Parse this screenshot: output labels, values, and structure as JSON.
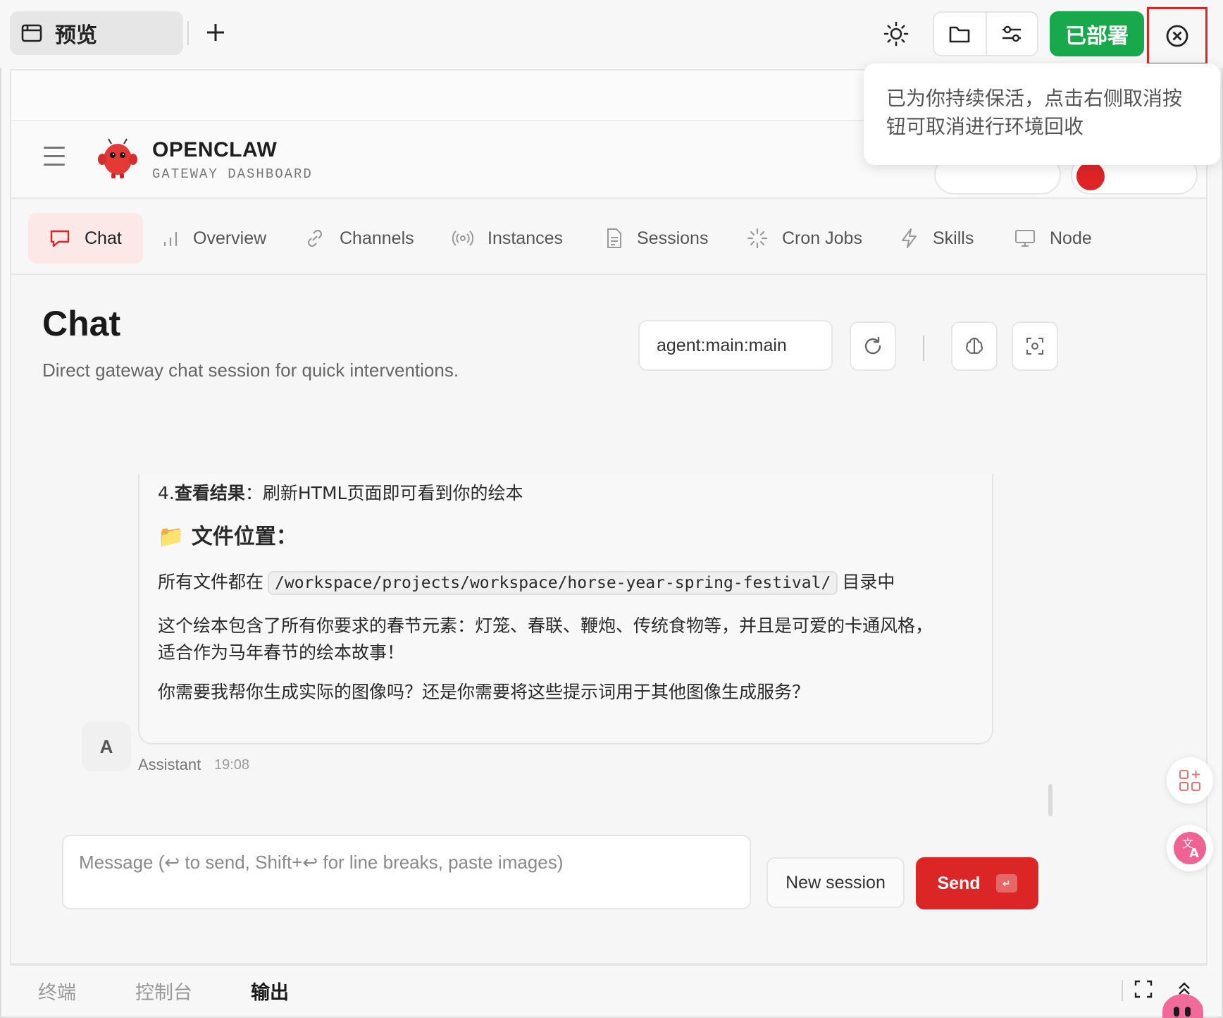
{
  "topbar": {
    "preview_tab_label": "预览",
    "deployed_label": "已部署"
  },
  "tooltip": {
    "text": "已为你持续保活，点击右侧取消按钮可取消进行环境回收"
  },
  "brand": {
    "title": "OPENCLAW",
    "subtitle": "GATEWAY DASHBOARD"
  },
  "nav": {
    "items": [
      {
        "label": "Chat",
        "icon": "chat-bubble-icon",
        "active": true
      },
      {
        "label": "Overview",
        "icon": "bar-chart-icon"
      },
      {
        "label": "Channels",
        "icon": "link-icon"
      },
      {
        "label": "Instances",
        "icon": "broadcast-icon"
      },
      {
        "label": "Sessions",
        "icon": "document-icon"
      },
      {
        "label": "Cron Jobs",
        "icon": "loader-icon"
      },
      {
        "label": "Skills",
        "icon": "lightning-icon"
      },
      {
        "label": "Node",
        "icon": "monitor-icon"
      }
    ]
  },
  "chat": {
    "title": "Chat",
    "subtitle": "Direct gateway chat session for quick interventions.",
    "session_value": "agent:main:main"
  },
  "message": {
    "step_number": "4.",
    "step_bold": "查看结果",
    "step_rest": "：刷新HTML页面即可看到你的绘本",
    "file_emoji": "📁",
    "file_heading": "文件位置：",
    "files_prefix": "所有文件都在",
    "files_path": "/workspace/projects/workspace/horse-year-spring-festival/",
    "files_suffix": "目录中",
    "para1_line1": "这个绘本包含了所有你要求的春节元素：灯笼、春联、鞭炮、传统食物等，并且是可爱的卡通风格，",
    "para1_line2": "适合作为马年春节的绘本故事！",
    "para2": "你需要我帮你生成实际的图像吗？还是你需要将这些提示词用于其他图像生成服务？",
    "avatar_letter": "A",
    "sender": "Assistant",
    "time": "19:08"
  },
  "composer": {
    "placeholder": "Message (↩ to send, Shift+↩ for line breaks, paste images)",
    "new_session_label": "New session",
    "send_label": "Send",
    "send_kbd": "↵"
  },
  "bottom": {
    "tabs": [
      {
        "label": "终端"
      },
      {
        "label": "控制台"
      },
      {
        "label": "输出",
        "active": true
      }
    ]
  },
  "colors": {
    "accent_red": "#dc2626",
    "deployed_green": "#18a94c",
    "active_tab_bg": "#fde8e8"
  }
}
